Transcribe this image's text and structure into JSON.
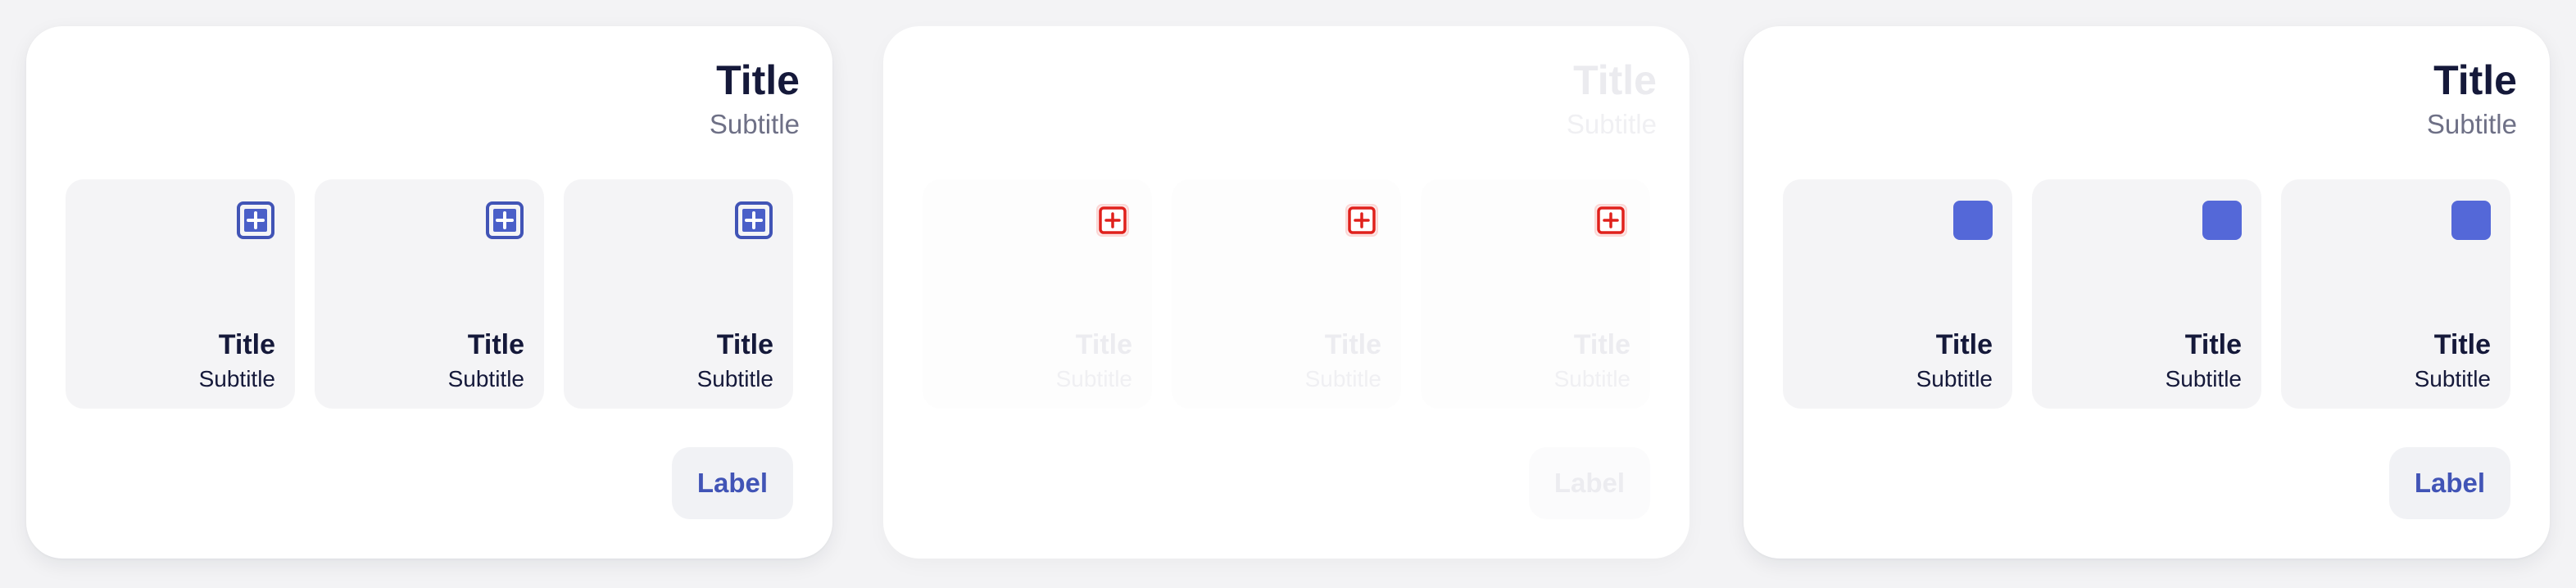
{
  "colors": {
    "accent": "#4154b6",
    "accent_fill": "#5468d8",
    "danger": "#e0211c",
    "title": "#15193a",
    "muted": "#6e7086",
    "tile_bg": "#f4f4f6"
  },
  "panels": [
    {
      "state": "default",
      "title": "Title",
      "subtitle": "Subtitle",
      "icon": "plus-square-icon",
      "tiles": [
        {
          "title": "Title",
          "subtitle": "Subtitle"
        },
        {
          "title": "Title",
          "subtitle": "Subtitle"
        },
        {
          "title": "Title",
          "subtitle": "Subtitle"
        }
      ],
      "button_label": "Label"
    },
    {
      "state": "disabled",
      "title": "Title",
      "subtitle": "Subtitle",
      "icon": "plus-square-icon",
      "tiles": [
        {
          "title": "Title",
          "subtitle": "Subtitle"
        },
        {
          "title": "Title",
          "subtitle": "Subtitle"
        },
        {
          "title": "Title",
          "subtitle": "Subtitle"
        }
      ],
      "button_label": "Label"
    },
    {
      "state": "filled",
      "title": "Title",
      "subtitle": "Subtitle",
      "icon": "filled-square-icon",
      "tiles": [
        {
          "title": "Title",
          "subtitle": "Subtitle"
        },
        {
          "title": "Title",
          "subtitle": "Subtitle"
        },
        {
          "title": "Title",
          "subtitle": "Subtitle"
        }
      ],
      "button_label": "Label"
    }
  ]
}
